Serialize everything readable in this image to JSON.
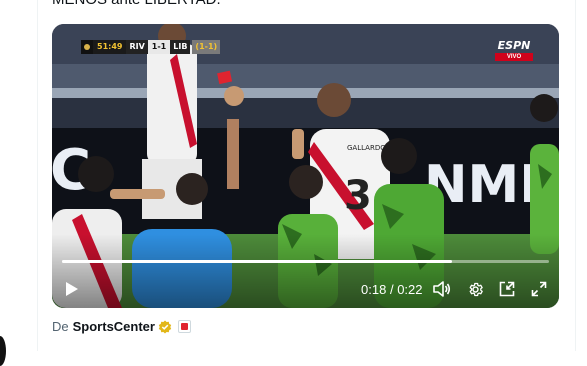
{
  "tweet": {
    "text_fragment": "MENOS ante LIBERTAD."
  },
  "video": {
    "scorebug": {
      "clock": "51:49",
      "home_team": "RIV",
      "score": "1-1",
      "away_team": "LIB",
      "aggregate": "(1-1)"
    },
    "broadcaster": {
      "logo": "ESPN",
      "live_label": "VIVO"
    },
    "graphics": {
      "banner_text_left": "C",
      "banner_text_mid": "NMEB",
      "shirt_number": "3",
      "shirt_name": "GALLARDO"
    },
    "controls": {
      "current_time": "0:18",
      "separator": "/",
      "duration": "0:22",
      "progress_fraction": 0.8,
      "play_icon": "play-icon",
      "volume_icon": "volume-icon",
      "settings_icon": "gear-icon",
      "pip_icon": "picture-in-picture-icon",
      "fullscreen_icon": "fullscreen-icon"
    }
  },
  "attribution": {
    "prefix": "De",
    "source": "SportsCenter",
    "verified_color": "#e2b719",
    "affiliate_color": "#e0242f"
  }
}
